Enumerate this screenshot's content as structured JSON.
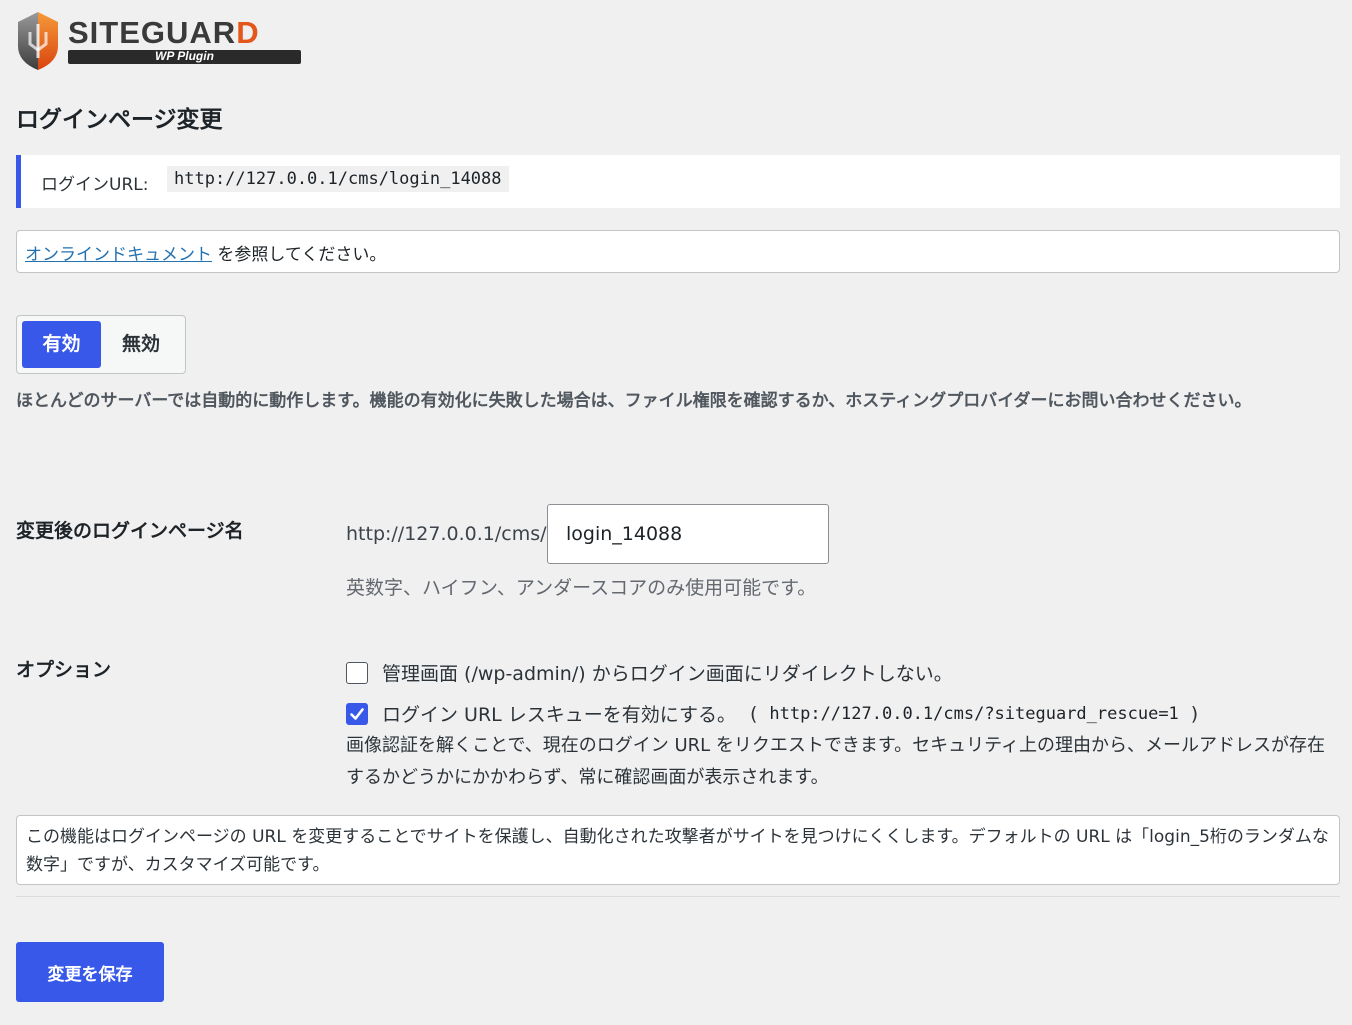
{
  "logo": {
    "word_main": "SITEGUAR",
    "word_accent": "D",
    "tagline": "WP Plugin"
  },
  "page_title": "ログインページ変更",
  "notice": {
    "label": "ログインURL:",
    "url": "http://127.0.0.1/cms/login_14088"
  },
  "doc": {
    "link_text": "オンラインドキュメント",
    "suffix": " を参照してください。"
  },
  "toggle": {
    "on_label": "有効",
    "off_label": "無効",
    "selected": "有効"
  },
  "toggle_help": "ほとんどのサーバーでは自動的に動作します。機能の有効化に失敗した場合は、ファイル権限を確認するか、ホスティングプロバイダーにお問い合わせください。",
  "login_name": {
    "label": "変更後のログインページ名",
    "prefix": "http://127.0.0.1/cms/",
    "value": "login_14088",
    "hint": "英数字、ハイフン、アンダースコアのみ使用可能です。"
  },
  "options": {
    "label": "オプション",
    "no_redirect": {
      "text": "管理画面 (/wp-admin/) からログイン画面にリダイレクトしない。",
      "checked": false
    },
    "rescue": {
      "text": "ログイン URL レスキューを有効にする。",
      "paren_open": "(",
      "url": "http://127.0.0.1/cms/?siteguard_rescue=1",
      "paren_close": ")",
      "checked": true
    },
    "rescue_desc": "画像認証を解くことで、現在のログイン URL をリクエストできます。セキュリティ上の理由から、メールアドレスが存在するかどうかにかかわらず、常に確認画面が表示されます。"
  },
  "info": "この機能はログインページの URL を変更することでサイトを保護し、自動化された攻撃者がサイトを見つけにくくします。デフォルトの URL は「login_5桁のランダムな数字」ですが、カスタマイズ可能です。",
  "save_label": "変更を保存",
  "colors": {
    "accent": "#3858e9",
    "logo_orange": "#e4561a",
    "link": "#2271b1",
    "background": "#f0f0f1"
  }
}
